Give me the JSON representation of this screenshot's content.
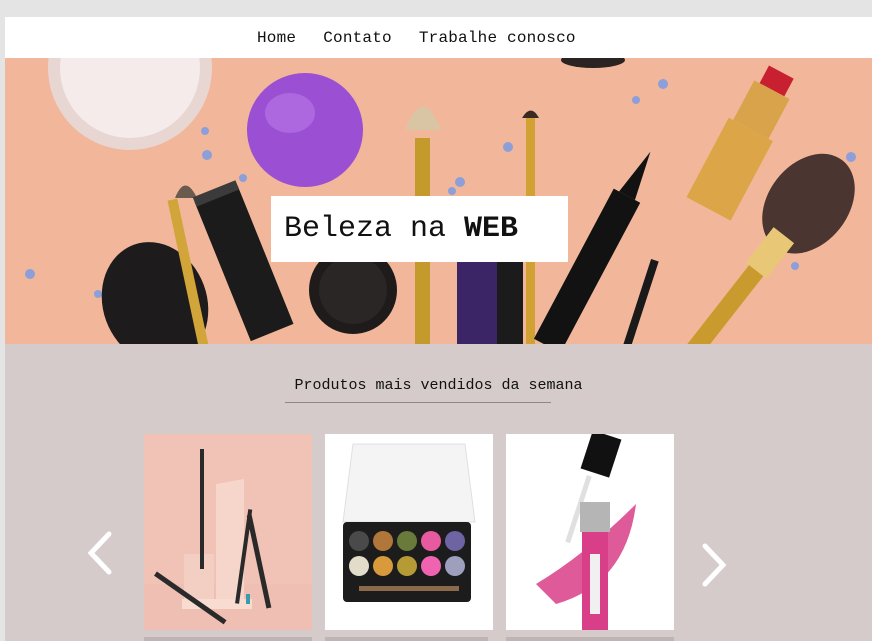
{
  "nav": {
    "items": [
      "Home",
      "Contato",
      "Trabalhe conosco"
    ]
  },
  "hero": {
    "title_prefix": "Beleza na ",
    "title_emphasis": "WEB"
  },
  "products": {
    "title": "Produtos mais vendidos da semana",
    "prev_arrow": "‹",
    "next_arrow": "›",
    "cards": [
      {
        "name": "eyeliner-pencils-card"
      },
      {
        "name": "eyeshadow-palette-card"
      },
      {
        "name": "lip-gloss-card"
      }
    ]
  },
  "colors": {
    "hero_bg": "#f2b79a",
    "section_bg": "#d4cbca",
    "page_bg": "#e4e4e4"
  }
}
